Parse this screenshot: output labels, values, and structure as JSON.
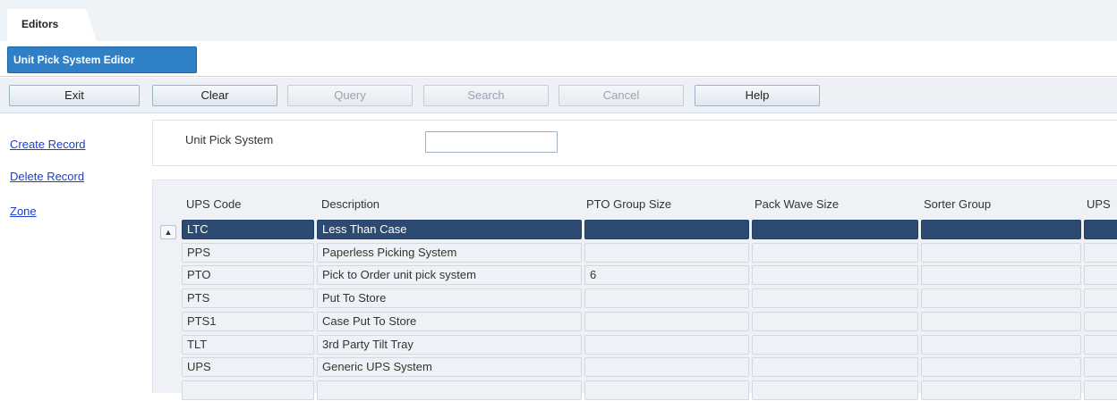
{
  "tabs": {
    "main": "Editors",
    "editor": "Unit Pick System Editor"
  },
  "toolbar": {
    "exit": "Exit",
    "clear": "Clear",
    "query": "Query",
    "search": "Search",
    "cancel": "Cancel",
    "help": "Help",
    "disabled": [
      "query",
      "search",
      "cancel"
    ]
  },
  "links": {
    "create": "Create Record",
    "delete": "Delete Record",
    "zone": "Zone"
  },
  "search": {
    "label": "Unit Pick System",
    "value": ""
  },
  "grid": {
    "columns": [
      "UPS Code",
      "Description",
      "PTO Group Size",
      "Pack Wave Size",
      "Sorter Group",
      "UPS"
    ],
    "selected_row": 0,
    "rows": [
      [
        "LTC",
        "Less Than Case",
        "",
        "",
        "",
        ""
      ],
      [
        "PPS",
        "Paperless Picking System",
        "",
        "",
        "",
        ""
      ],
      [
        "PTO",
        "Pick to Order unit pick system",
        "6",
        "",
        "",
        ""
      ],
      [
        "PTS",
        "Put To Store",
        "",
        "",
        "",
        ""
      ],
      [
        "PTS1",
        "Case Put To Store",
        "",
        "",
        "",
        ""
      ],
      [
        "TLT",
        "3rd Party Tilt Tray",
        "",
        "",
        "",
        ""
      ],
      [
        "UPS",
        "Generic UPS System",
        "",
        "",
        "",
        ""
      ],
      [
        "",
        "",
        "",
        "",
        "",
        ""
      ]
    ]
  },
  "colors": {
    "accent": "#2f80c6",
    "selected_row": "#2c4a72",
    "link": "#1a3fcf"
  },
  "icons": {
    "scroll_up": "triangle-up-icon"
  }
}
